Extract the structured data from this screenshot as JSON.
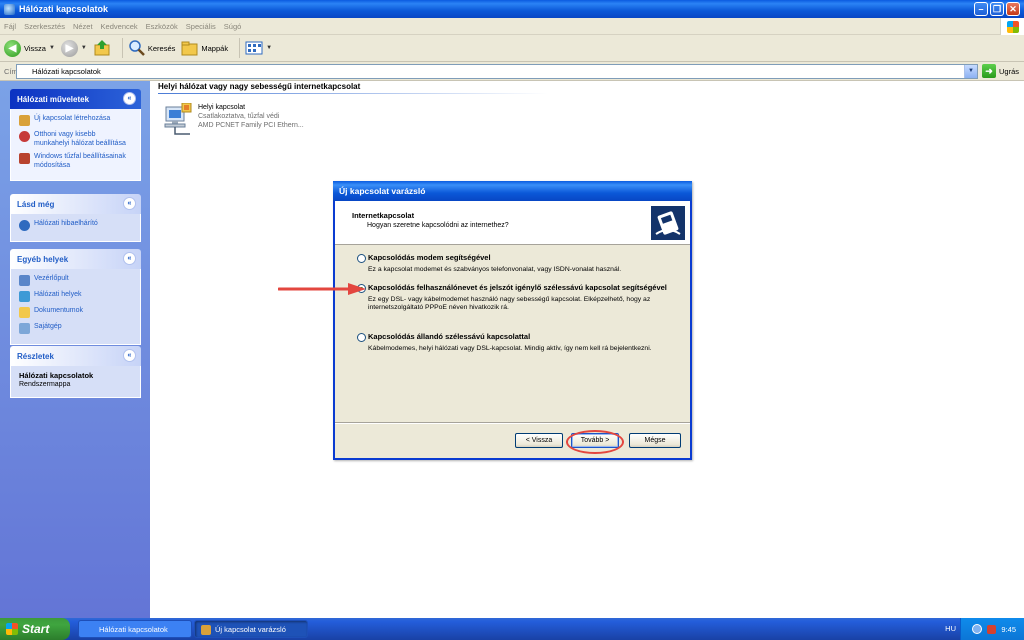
{
  "window": {
    "title": "Hálózati kapcsolatok"
  },
  "menu": {
    "items": [
      "Fájl",
      "Szerkesztés",
      "Nézet",
      "Kedvencek",
      "Eszközök",
      "Speciális",
      "Súgó"
    ]
  },
  "toolbar": {
    "back": "Vissza",
    "search": "Keresés",
    "folders": "Mappák"
  },
  "address": {
    "label": "Cím",
    "value": "Hálózati kapcsolatok",
    "go": "Ugrás"
  },
  "sidebar": {
    "network_tasks": {
      "title": "Hálózati műveletek",
      "items": [
        "Új kapcsolat létrehozása",
        "Otthoni vagy kisebb munkahelyi hálózat beállítása",
        "Windows tűzfal beállításainak módosítása"
      ]
    },
    "see_also": {
      "title": "Lásd még",
      "items": [
        "Hálózati hibaelhárító"
      ]
    },
    "other_places": {
      "title": "Egyéb helyek",
      "items": [
        "Vezérlőpult",
        "Hálózati helyek",
        "Dokumentumok",
        "Sajátgép"
      ]
    },
    "details": {
      "title": "Részletek",
      "name": "Hálózati kapcsolatok",
      "type": "Rendszermappa"
    }
  },
  "main": {
    "group_title": "Helyi hálózat vagy nagy sebességű internetkapcsolat",
    "connection": {
      "name": "Helyi kapcsolat",
      "status": "Csatlakoztatva, tűzfal védi",
      "device": "AMD PCNET Family PCI Ethern..."
    }
  },
  "wizard": {
    "title": "Új kapcsolat varázsló",
    "heading": "Internetkapcsolat",
    "subheading": "Hogyan szeretne kapcsolódni az internethez?",
    "options": [
      {
        "label": "Kapcsolódás modem segítségével",
        "desc": "Ez a kapcsolat modemet és szabványos telefonvonalat, vagy ISDN-vonalat használ.",
        "selected": false
      },
      {
        "label": "Kapcsolódás felhasználónevet és jelszót igénylő szélessávú kapcsolat segítségével",
        "desc": "Ez egy DSL- vagy kábelmodemet használó nagy sebességű kapcsolat. Elképzelhető, hogy az internetszolgáltató PPPoE néven hivatkozik rá.",
        "selected": true
      },
      {
        "label": "Kapcsolódás állandó szélessávú kapcsolattal",
        "desc": "Kábelmodemes, helyi hálózati vagy DSL-kapcsolat. Mindig aktív, így nem kell rá bejelentkezni.",
        "selected": false
      }
    ],
    "buttons": {
      "back": "< Vissza",
      "next": "Tovább >",
      "cancel": "Mégse"
    }
  },
  "taskbar": {
    "start": "Start",
    "tasks": [
      "Hálózati kapcsolatok",
      "Új kapcsolat varázsló"
    ],
    "lang": "HU",
    "clock": "9:45"
  },
  "colors": {
    "annotation": "#e3463f",
    "title_blue": "#0a5be0",
    "xp_green": "#3c9a3c"
  }
}
